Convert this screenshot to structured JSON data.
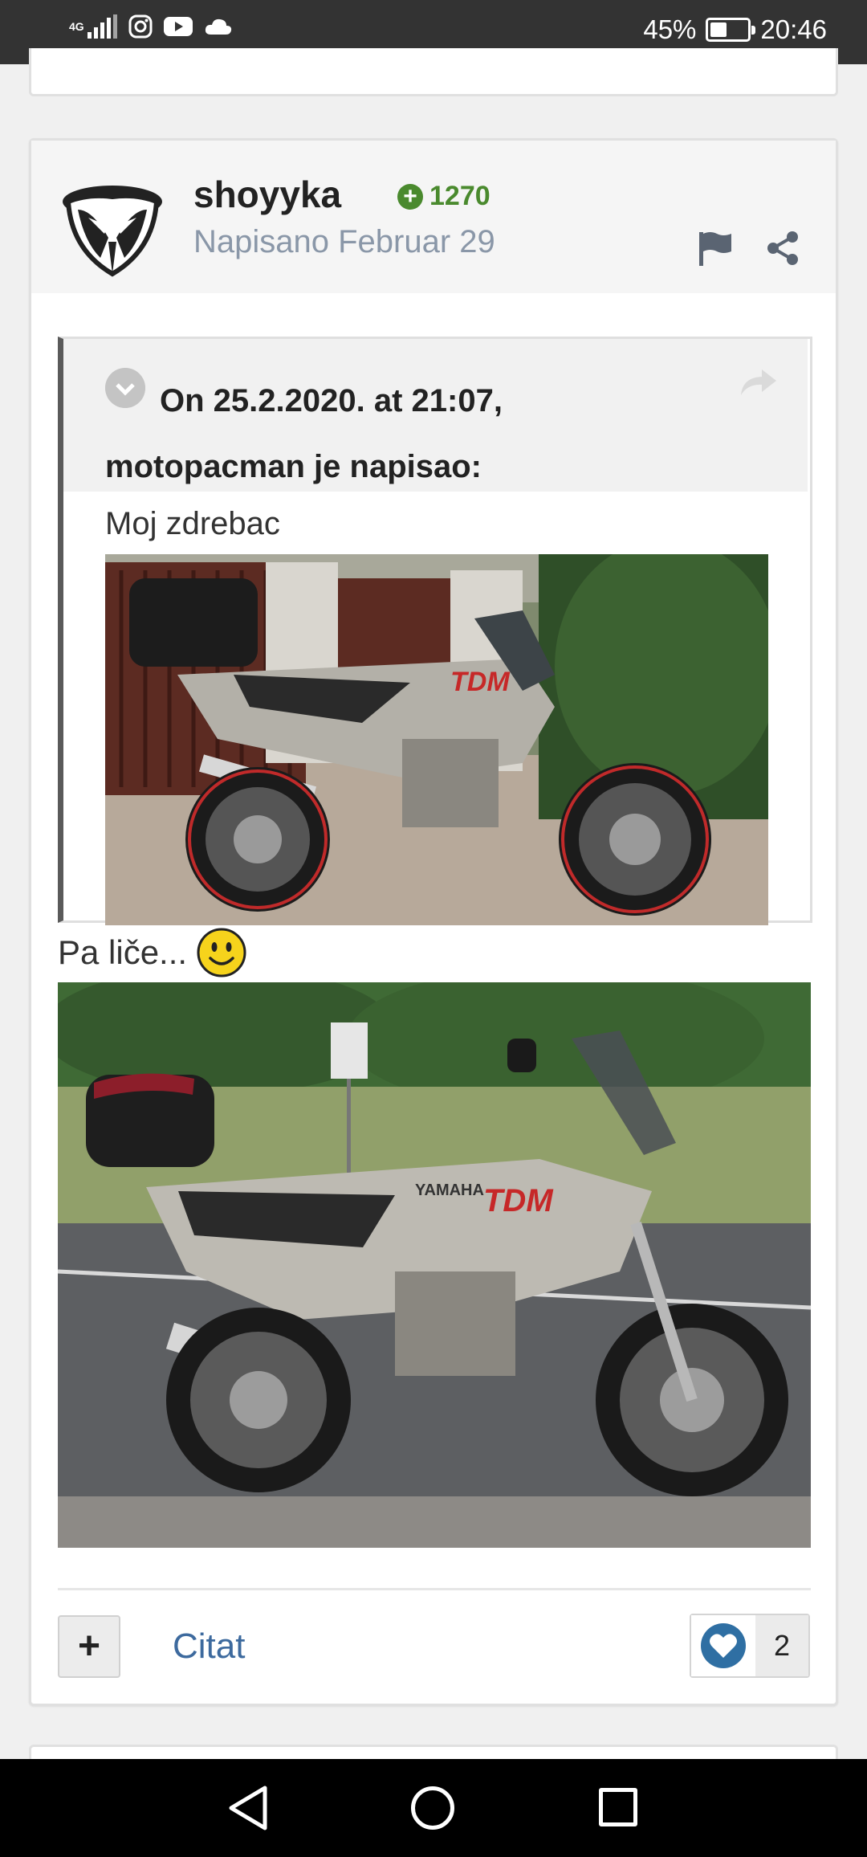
{
  "status_bar": {
    "network": "4G",
    "battery_percent_text": "45%",
    "battery_level": 0.45,
    "time": "20:46",
    "icons": [
      "signal-icon",
      "instagram-icon",
      "youtube-icon",
      "cloud-icon"
    ]
  },
  "post": {
    "author": "shoyyka",
    "reputation": "1270",
    "posted": "Napisano Februar 29",
    "quote": {
      "title_line1": "On 25.2.2020. at 21:07,",
      "title_line2": "motopacman je napisao:",
      "text": "Moj zdrebac",
      "image_alt": "motorcycle-photo-gate"
    },
    "text": "Pa liče...",
    "image_alt": "motorcycle-photo-road",
    "actions": {
      "plus": "+",
      "quote_label": "Citat",
      "likes": "2"
    }
  },
  "colors": {
    "status_bar": "#333333",
    "reputation": "#4a8a2e",
    "link": "#3d6a9e",
    "heart": "#2f6fa3"
  }
}
